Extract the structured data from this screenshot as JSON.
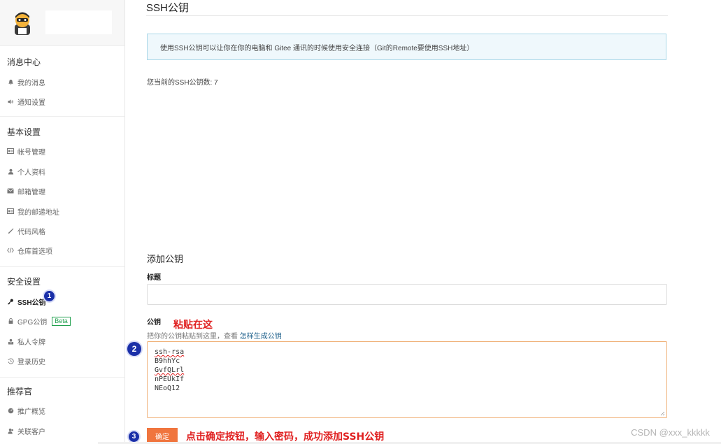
{
  "sidebar": {
    "sections": [
      {
        "title": "消息中心",
        "items": [
          {
            "label": "我的消息",
            "icon": "bell-icon"
          },
          {
            "label": "通知设置",
            "icon": "volume-icon"
          }
        ]
      },
      {
        "title": "基本设置",
        "items": [
          {
            "label": "帐号管理",
            "icon": "id-card-icon"
          },
          {
            "label": "个人资料",
            "icon": "user-icon"
          },
          {
            "label": "邮箱管理",
            "icon": "envelope-icon"
          },
          {
            "label": "我的邮递地址",
            "icon": "id-card-icon"
          },
          {
            "label": "代码风格",
            "icon": "brush-icon"
          },
          {
            "label": "仓库首选项",
            "icon": "code-icon"
          }
        ]
      },
      {
        "title": "安全设置",
        "items": [
          {
            "label": "SSH公钥",
            "icon": "key-icon",
            "active": true
          },
          {
            "label": "GPG公钥",
            "icon": "lock-icon",
            "badge": "Beta"
          },
          {
            "label": "私人令牌",
            "icon": "token-icon"
          },
          {
            "label": "登录历史",
            "icon": "history-icon"
          }
        ]
      },
      {
        "title": "推荐官",
        "items": [
          {
            "label": "推广概览",
            "icon": "gauge-icon"
          },
          {
            "label": "关联客户",
            "icon": "users-icon"
          }
        ]
      }
    ]
  },
  "main": {
    "title": "SSH公钥",
    "info": "使用SSH公钥可以让你在你的电脑和 Gitee 通讯的时候使用安全连接（Git的Remote要使用SSH地址）",
    "key_count": "您当前的SSH公钥数: 7",
    "add_title": "添加公钥",
    "title_label": "标题",
    "title_value": "",
    "pubkey_label": "公钥",
    "pubkey_hint": "把你的公钥粘贴到这里，查看",
    "pubkey_hint_link": "怎样生成公钥",
    "pubkey_lines": [
      "ssh-rsa",
      "B9hhYc",
      "GvfQLrl",
      "nPEUkIf",
      "NEoQ12"
    ],
    "confirm_label": "确定"
  },
  "annotations": {
    "steps": [
      "1",
      "2",
      "3"
    ],
    "paste_here": "粘贴在这",
    "instruction": "点击确定按钮，输入密码，成功添加SSH公钥",
    "color": "#e02020"
  },
  "watermark": "CSDN @xxx_kkkkk",
  "colors": {
    "accent": "#f0753e",
    "info_border": "#a9d7e8",
    "info_bg": "#eff8fc",
    "beta": "#21a04e",
    "link": "#1c5f8a",
    "step_badge": "#1a2fa8"
  }
}
